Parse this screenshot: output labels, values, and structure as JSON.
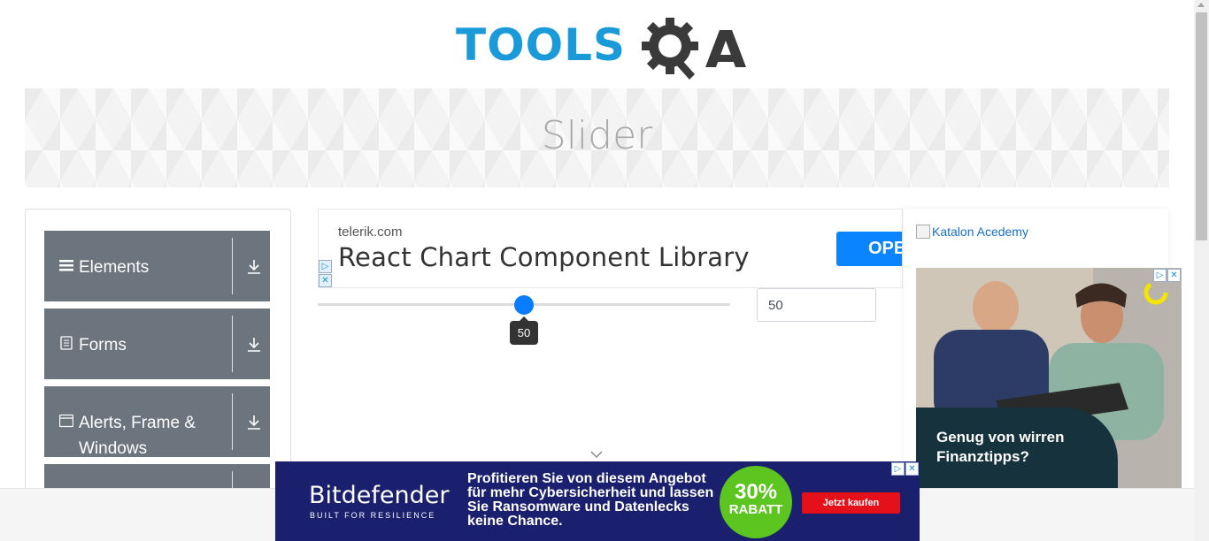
{
  "header": {
    "logo_tools": "TOOLS",
    "logo_qa": "QA"
  },
  "banner": {
    "title": "Slider"
  },
  "leftnav": {
    "groups": [
      {
        "label": "Elements",
        "icon": "menu-icon"
      },
      {
        "label": "Forms",
        "icon": "document-icon"
      },
      {
        "label": "Alerts, Frame & Windows",
        "icon": "window-icon"
      },
      {
        "label": "",
        "icon": ""
      }
    ]
  },
  "ad_top": {
    "domain": "telerik.com",
    "headline": "React Chart Component Library",
    "button": "OPE"
  },
  "slider": {
    "value": 50,
    "min": 0,
    "max": 100,
    "tooltip": "50",
    "input_value": "50"
  },
  "right_ad": {
    "broken_image_alt": "Katalon Acedemy",
    "caption": "Genug von wirren Finanztipps?"
  },
  "bottom_ad": {
    "brand": "Bitdefender",
    "tagline": "BUILT FOR RESILIENCE",
    "copy": "Profitieren Sie von diesem Angebot für mehr Cybersicherheit und lassen Sie Ransomware und Datenlecks keine Chance.",
    "badge_pct": "30%",
    "badge_label": "RABATT",
    "cta": "Jetzt kaufen"
  },
  "colors": {
    "logo_blue": "#1a9ad8",
    "logo_dark": "#3a3a3a",
    "nav_group_bg": "#6c757d",
    "slider_accent": "#0a7cff",
    "bitdefender_bg": "#1a1f6e",
    "badge_green": "#5cc520",
    "cta_red": "#e4101a"
  }
}
